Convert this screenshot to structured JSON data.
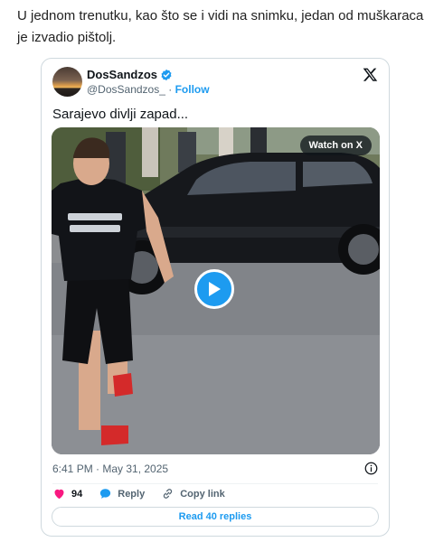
{
  "article": {
    "paragraph": "U jednom trenutku, kao što se i vidi na snimku, jedan od muškaraca je izvadio pištolj."
  },
  "tweet": {
    "author": {
      "display_name": "DosSandzos",
      "handle": "@DosSandzos_",
      "separator": "·",
      "follow_label": "Follow",
      "verified": true
    },
    "text": "Sarajevo divlji zapad...",
    "media": {
      "watch_label": "Watch on X",
      "shirt_text": "SARAJEVSKI MANGUPI"
    },
    "timestamp": "6:41 PM · May 31, 2025",
    "actions": {
      "like_count": "94",
      "reply_label": "Reply",
      "copy_label": "Copy link"
    },
    "read_replies_label": "Read 40 replies"
  },
  "colors": {
    "accent": "#1d9bf0",
    "like": "#f91880",
    "muted_text": "#536471"
  },
  "icons": [
    "verified-badge-icon",
    "x-logo-icon",
    "play-icon",
    "info-icon",
    "heart-icon",
    "reply-bubble-icon",
    "link-icon"
  ]
}
